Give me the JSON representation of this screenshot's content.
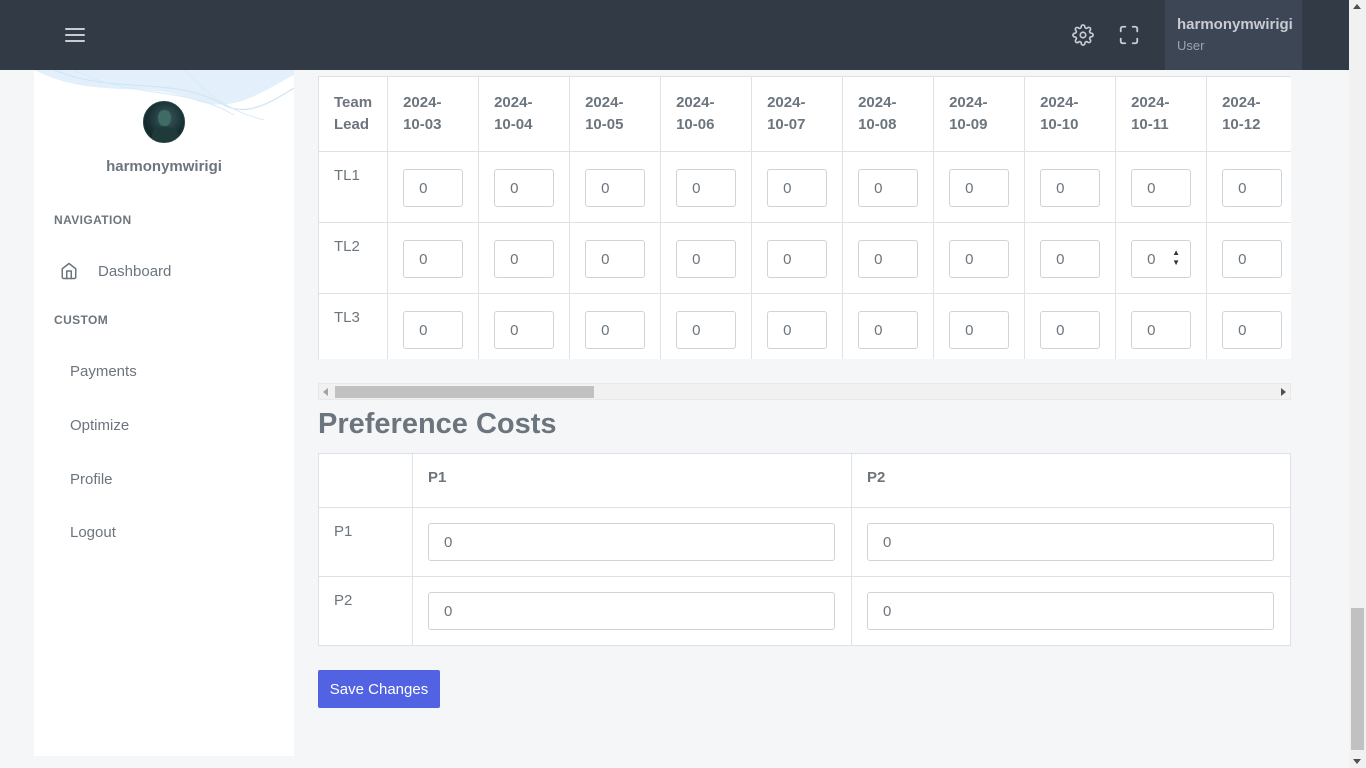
{
  "topbar": {
    "user_name": "harmonymwirigi",
    "user_role": "User"
  },
  "sidebar": {
    "username": "harmonymwirigi",
    "nav_title": "NAVIGATION",
    "dashboard_label": "Dashboard",
    "custom_title": "CUSTOM",
    "items": [
      {
        "label": "Payments"
      },
      {
        "label": "Optimize"
      },
      {
        "label": "Profile"
      },
      {
        "label": "Logout"
      }
    ]
  },
  "availability": {
    "header": "Team Lead",
    "dates": [
      "2024-10-03",
      "2024-10-04",
      "2024-10-05",
      "2024-10-06",
      "2024-10-07",
      "2024-10-08",
      "2024-10-09",
      "2024-10-10",
      "2024-10-11",
      "2024-10-12"
    ],
    "rows": [
      {
        "label": "TL1",
        "values": [
          "0",
          "0",
          "0",
          "0",
          "0",
          "0",
          "0",
          "0",
          "0",
          "0"
        ]
      },
      {
        "label": "TL2",
        "values": [
          "0",
          "0",
          "0",
          "0",
          "0",
          "0",
          "0",
          "0",
          "0",
          "0"
        ]
      },
      {
        "label": "TL3",
        "values": [
          "0",
          "0",
          "0",
          "0",
          "0",
          "0",
          "0",
          "0",
          "0",
          "0"
        ]
      }
    ],
    "horizontal_scroll_fraction": 0.0
  },
  "preference": {
    "title": "Preference Costs",
    "columns": [
      "P1",
      "P2"
    ],
    "rows": [
      {
        "label": "P1",
        "values": [
          "0",
          "0"
        ]
      },
      {
        "label": "P2",
        "values": [
          "0",
          "0"
        ]
      }
    ]
  },
  "save_label": "Save Changes",
  "colors": {
    "topbar": "#323a46",
    "primary": "#5162e3",
    "text": "#6c757d"
  },
  "icons": [
    "menu-icon",
    "gear-icon",
    "fullscreen-icon",
    "home-icon"
  ]
}
